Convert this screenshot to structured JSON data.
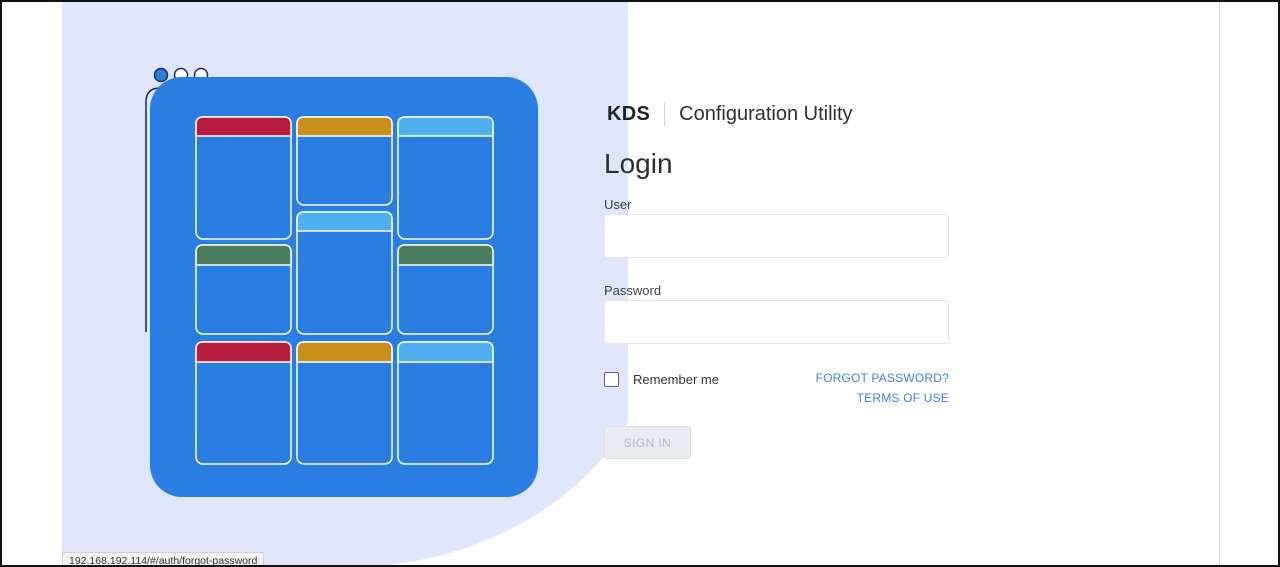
{
  "brand": {
    "short": "KDS",
    "title": "Configuration Utility"
  },
  "login": {
    "heading": "Login",
    "user_label": "User",
    "user_value": "",
    "password_label": "Password",
    "password_value": "",
    "remember_label": "Remember me",
    "remember_checked": false,
    "forgot_password": "FORGOT PASSWORD?",
    "terms_of_use": "TERMS OF USE",
    "signin_label": "SIGN IN",
    "signin_enabled": false
  },
  "illustration": {
    "window_dots": [
      "dot-active",
      "dot",
      "dot"
    ],
    "tile_header_colors": [
      "#b71c3f",
      "#c8901a",
      "#4fb0f0",
      "#4fb0f0",
      "#4a7c5f",
      "#4a7c5f",
      "#b71c3f",
      "#c8901a",
      "#4fb0f0"
    ],
    "panel_color": "#2a7de1",
    "background_blob": "#dfe6fb"
  },
  "status_bar": {
    "url": "192.168.192.114/#/auth/forgot-password"
  }
}
